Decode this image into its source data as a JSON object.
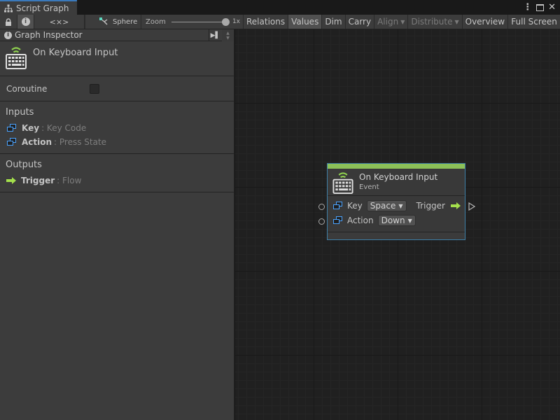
{
  "window": {
    "tab_label": "Script Graph",
    "tab_icon": "hierarchy-icon",
    "controls": [
      "more-options-icon",
      "maximize-icon",
      "close-icon"
    ]
  },
  "toolbar": {
    "lock_icon": "lock-icon",
    "info_icon": "info-icon",
    "code_label": "<×>",
    "sphere_label": "Sphere",
    "zoom_label": "Zoom",
    "zoom_value": "1x",
    "zoom_fraction": 1.0,
    "buttons": [
      {
        "label": "Relations",
        "active": false,
        "disabled": false
      },
      {
        "label": "Values",
        "active": true,
        "disabled": false
      },
      {
        "label": "Dim",
        "active": false,
        "disabled": false
      },
      {
        "label": "Carry",
        "active": false,
        "disabled": false
      },
      {
        "label": "Align",
        "active": false,
        "disabled": true,
        "dropdown": true
      },
      {
        "label": "Distribute",
        "active": false,
        "disabled": true,
        "dropdown": true
      },
      {
        "label": "Overview",
        "active": false,
        "disabled": false
      },
      {
        "label": "Full Screen",
        "active": false,
        "disabled": false
      }
    ]
  },
  "inspector": {
    "header_title": "Graph Inspector",
    "node_title": "On Keyboard Input",
    "node_icon": "keyboard-icon",
    "coroutine_label": "Coroutine",
    "coroutine_checked": false,
    "inputs_heading": "Inputs",
    "inputs": [
      {
        "name": "Key",
        "type": ": Key Code"
      },
      {
        "name": "Action",
        "type": ": Press State"
      }
    ],
    "outputs_heading": "Outputs",
    "outputs": [
      {
        "name": "Trigger",
        "type": ": Flow"
      }
    ]
  },
  "node": {
    "title": "On Keyboard Input",
    "subtitle": "Event",
    "accent_color": "#8bc158",
    "key_label": "Key",
    "key_value": "Space",
    "action_label": "Action",
    "action_value": "Down",
    "trigger_label": "Trigger"
  },
  "colors": {
    "flow_green": "#a4e04c",
    "value_port_blue": "#4aa3ff",
    "selection_border": "#3f7fa6"
  }
}
